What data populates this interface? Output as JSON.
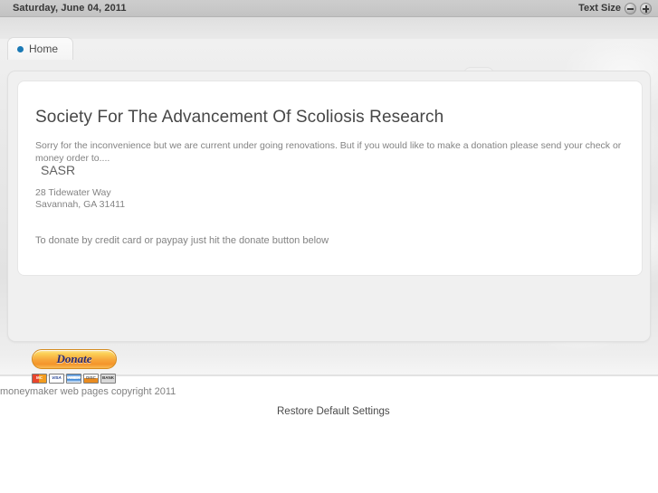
{
  "topbar": {
    "date": "Saturday, June 04, 2011",
    "text_size_label": "Text Size",
    "decrease_icon": "minus-circle-icon",
    "increase_icon": "plus-circle-icon"
  },
  "nav": {
    "tabs": [
      {
        "label": "Home",
        "bullet_color": "#1a79b5",
        "active": true
      }
    ]
  },
  "content": {
    "title": "Society For The Advancement Of Scoliosis Research",
    "paragraph": "Sorry for the inconvenience but we are current under going renovations. But if you would like to make a donation please send your check or money order to....",
    "org_name": "SASR",
    "address_line1": "28 Tidewater Way",
    "address_line2": "Savannah, GA 31411",
    "donate_note": "To donate by credit card or paypay just hit the donate button below"
  },
  "donate": {
    "button_label": "Donate",
    "cards": [
      {
        "name": "mastercard-icon",
        "label": "MC"
      },
      {
        "name": "visa-icon",
        "label": "VISA"
      },
      {
        "name": "amex-icon",
        "label": "AMEX"
      },
      {
        "name": "discover-icon",
        "label": "DISC"
      },
      {
        "name": "bank-icon",
        "label": "BANK"
      }
    ]
  },
  "footer": {
    "copyright": "moneymaker web pages copyright 2011",
    "restore_label": "Restore Default Settings"
  },
  "colors": {
    "accent_blue": "#1a79b5",
    "topbar_gray": "#c8c8c8",
    "panel_gray": "#f0f0f0",
    "donate_orange": "#f7a83c"
  }
}
